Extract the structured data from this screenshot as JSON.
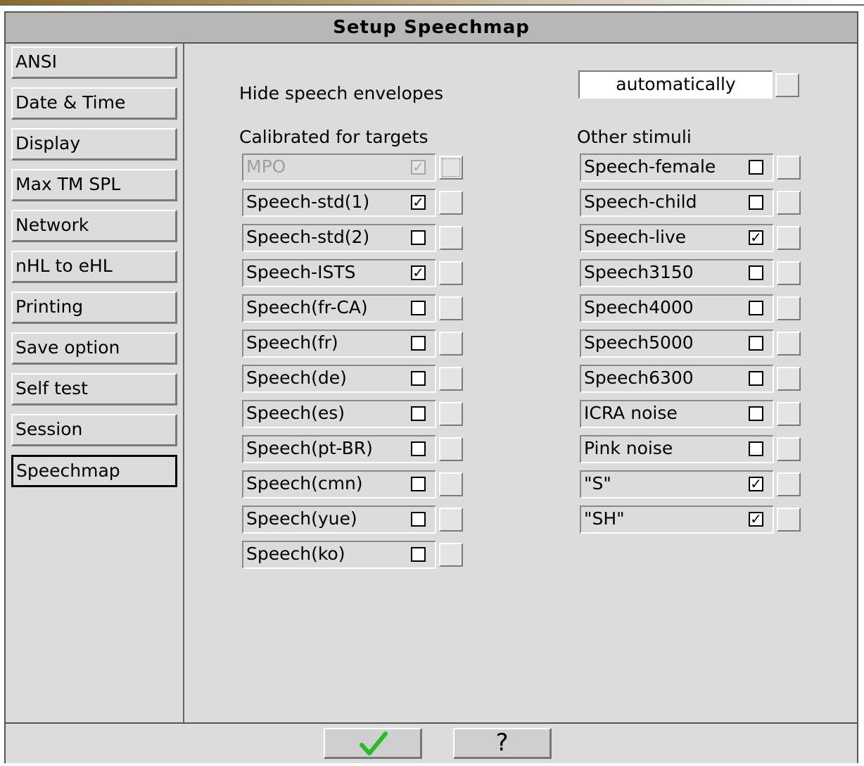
{
  "window": {
    "title": "Setup Speechmap"
  },
  "sidebar": {
    "items": [
      {
        "label": "ANSI",
        "active": false
      },
      {
        "label": "Date & Time",
        "active": false
      },
      {
        "label": "Display",
        "active": false
      },
      {
        "label": "Max TM SPL",
        "active": false
      },
      {
        "label": "Network",
        "active": false
      },
      {
        "label": "nHL to eHL",
        "active": false
      },
      {
        "label": "Printing",
        "active": false
      },
      {
        "label": "Save option",
        "active": false
      },
      {
        "label": "Self test",
        "active": false
      },
      {
        "label": "Session",
        "active": false
      },
      {
        "label": "Speechmap",
        "active": true
      }
    ]
  },
  "main": {
    "hide_label": "Hide speech envelopes",
    "hide_value": "automatically",
    "calibrated_heading": "Calibrated for targets",
    "other_heading": "Other stimuli",
    "calibrated": [
      {
        "label": "MPO",
        "checked": true,
        "disabled": true
      },
      {
        "label": "Speech-std(1)",
        "checked": true,
        "disabled": false
      },
      {
        "label": "Speech-std(2)",
        "checked": false,
        "disabled": false
      },
      {
        "label": "Speech-ISTS",
        "checked": true,
        "disabled": false
      },
      {
        "label": "Speech(fr-CA)",
        "checked": false,
        "disabled": false
      },
      {
        "label": "Speech(fr)",
        "checked": false,
        "disabled": false
      },
      {
        "label": "Speech(de)",
        "checked": false,
        "disabled": false
      },
      {
        "label": "Speech(es)",
        "checked": false,
        "disabled": false
      },
      {
        "label": "Speech(pt-BR)",
        "checked": false,
        "disabled": false
      },
      {
        "label": "Speech(cmn)",
        "checked": false,
        "disabled": false
      },
      {
        "label": "Speech(yue)",
        "checked": false,
        "disabled": false
      },
      {
        "label": "Speech(ko)",
        "checked": false,
        "disabled": false
      }
    ],
    "other": [
      {
        "label": "Speech-female",
        "checked": false,
        "disabled": false
      },
      {
        "label": "Speech-child",
        "checked": false,
        "disabled": false
      },
      {
        "label": "Speech-live",
        "checked": true,
        "disabled": false
      },
      {
        "label": "Speech3150",
        "checked": false,
        "disabled": false
      },
      {
        "label": "Speech4000",
        "checked": false,
        "disabled": false
      },
      {
        "label": "Speech5000",
        "checked": false,
        "disabled": false
      },
      {
        "label": "Speech6300",
        "checked": false,
        "disabled": false
      },
      {
        "label": "ICRA noise",
        "checked": false,
        "disabled": false
      },
      {
        "label": "Pink noise",
        "checked": false,
        "disabled": false
      },
      {
        "label": "\"S\"",
        "checked": true,
        "disabled": false
      },
      {
        "label": "\"SH\"",
        "checked": true,
        "disabled": false
      }
    ]
  },
  "footer": {
    "ok_icon": "checkmark-icon",
    "help_label": "?"
  },
  "colors": {
    "ok_green": "#22c022",
    "window_bg": "#dcdcdc",
    "title_bg": "#b7b7b7"
  },
  "glyphs": {
    "check": "✓"
  }
}
